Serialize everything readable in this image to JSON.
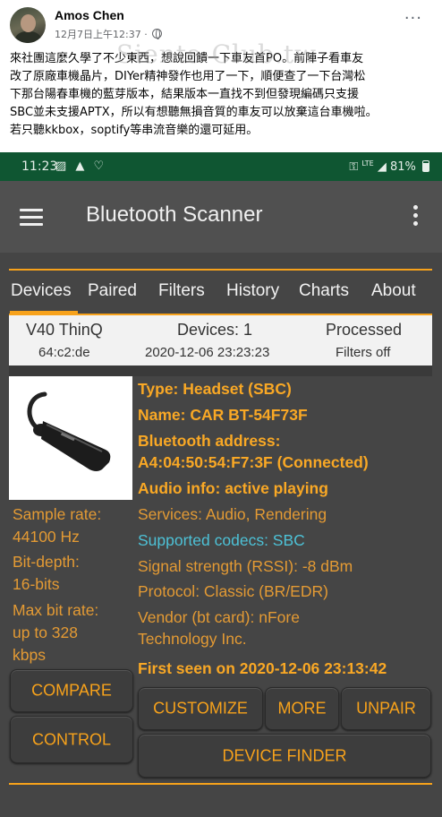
{
  "post": {
    "author": "Amos Chen",
    "time": "12月7日上午12:37 ·",
    "more": "···",
    "lines": [
      "來社團這麼久學了不少東西，想說回饋一下車友首PO。前陣子看車友",
      "改了原廠車機晶片，DIYer精神發作也用了一下，順便查了一下台灣松",
      "下那台陽春車機的藍芽版本，結果版本一直找不到但發現編碼只支援",
      "SBC並未支援APTX，所以有想聽無損音質的車友可以放棄這台車機啦。",
      "若只聽kkbox，soptify等串流音樂的還可延用。"
    ],
    "watermark": "Sienta Club.tw"
  },
  "phone": {
    "status": {
      "time": "11:23",
      "icons": "▨ ▲ ♡",
      "signal": "LTE",
      "battery": "81%"
    },
    "app": {
      "title": "Bluetooth Scanner"
    },
    "tabs": [
      "Devices",
      "Paired",
      "Filters",
      "History",
      "Charts",
      "About"
    ],
    "info": {
      "device_model": "V40 ThinQ",
      "mac": "64:c2:de",
      "devices_count": "Devices: 1",
      "timestamp": "2020-12-06 23:23:23",
      "processed": "Processed",
      "filters": "Filters off"
    },
    "details": {
      "type": "Type: Headset (SBC)",
      "name": "Name: CAR BT-54F73F",
      "address_label": "Bluetooth address:",
      "address": "A4:04:50:54:F7:3F (Connected)",
      "audio": "Audio info: active playing",
      "services": "Services: Audio, Rendering",
      "codecs": "Supported codecs: SBC",
      "rssi": "Signal strength (RSSI): -8 dBm",
      "protocol": "Protocol: Classic (BR/EDR)",
      "vendor1": "Vendor (bt card): nFore",
      "vendor2": "Technology Inc.",
      "first_seen": "First seen on 2020-12-06 23:13:42"
    },
    "stats": {
      "sample_label": "Sample rate:",
      "sample_value": "44100 Hz",
      "depth_label": "Bit-depth:",
      "depth_value": "16-bits",
      "maxrate_label": "Max bit rate:",
      "maxrate_value1": "up to 328",
      "maxrate_value2": "kbps"
    },
    "buttons": {
      "compare": "COMPARE",
      "control": "CONTROL",
      "customize": "CUSTOMIZE",
      "more": "MORE",
      "unpair": "UNPAIR",
      "finder": "DEVICE FINDER"
    },
    "colors": {
      "accent": "#f7a21b",
      "status_bar": "#0f5632",
      "app_bar": "#505050",
      "background": "#454545",
      "codec_highlight": "#4dc1d6"
    }
  }
}
